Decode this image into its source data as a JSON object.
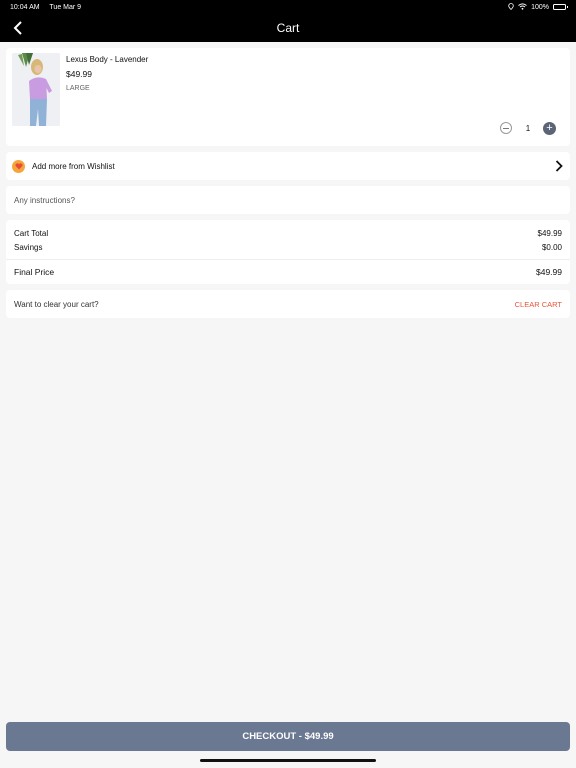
{
  "status_bar": {
    "time": "10:04 AM",
    "date": "Tue Mar 9",
    "battery": "100%",
    "icons": [
      "location-icon",
      "wifi-icon",
      "battery-icon"
    ]
  },
  "nav": {
    "title": "Cart",
    "back_icon": "back-chevron-icon"
  },
  "cart_item": {
    "name": "Lexus Body - Lavender",
    "price": "$49.99",
    "size": "LARGE",
    "quantity": "1",
    "image": "product-photo"
  },
  "wishlist": {
    "label": "Add more from Wishlist",
    "icon": "heart-icon",
    "icon_color": "#f4a63b"
  },
  "instructions": {
    "placeholder": "Any instructions?"
  },
  "totals": {
    "cart_total_label": "Cart Total",
    "cart_total_value": "$49.99",
    "savings_label": "Savings",
    "savings_value": "$0.00",
    "final_label": "Final Price",
    "final_value": "$49.99"
  },
  "clear": {
    "label": "Want to clear your cart?",
    "button": "CLEAR CART",
    "button_color": "#e5553a"
  },
  "checkout": {
    "label": "CHECKOUT - $49.99",
    "color": "#6b7891"
  }
}
